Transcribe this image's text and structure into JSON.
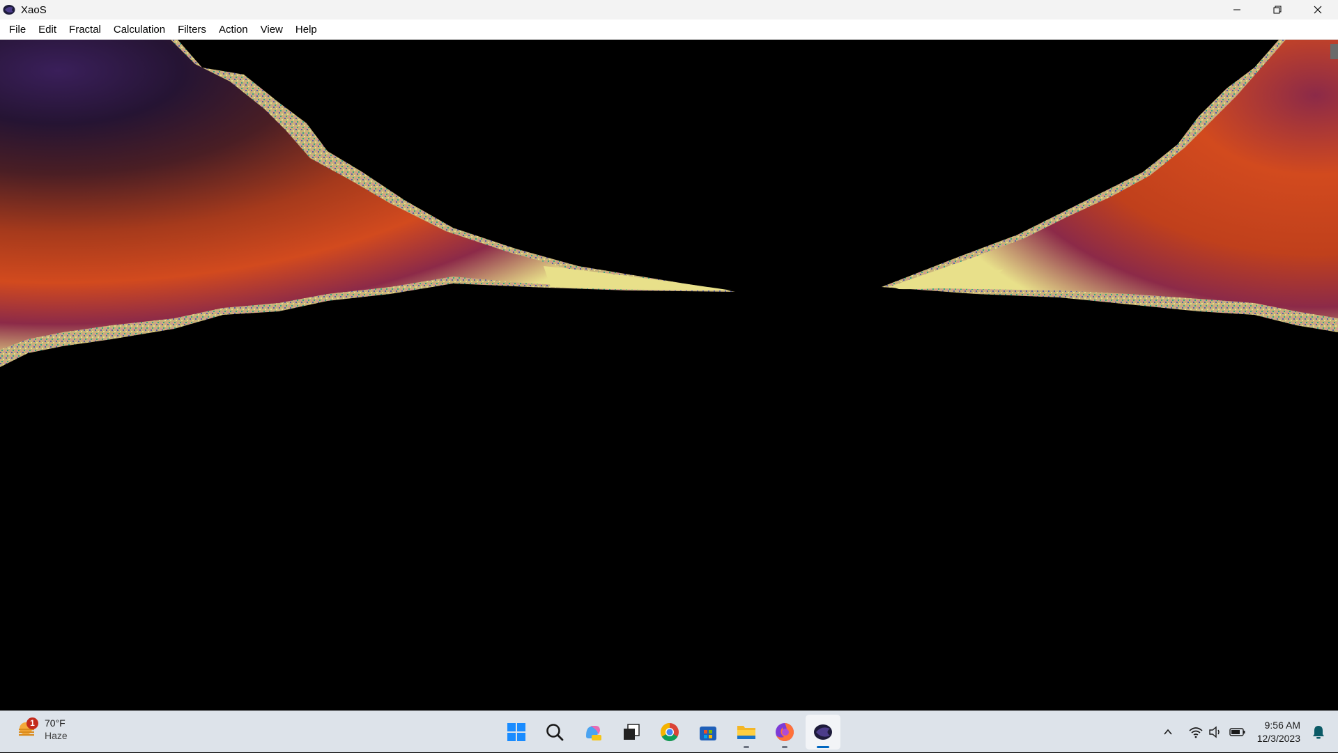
{
  "window": {
    "title": "XaoS",
    "icon": "xaos-app-icon"
  },
  "menu": [
    "File",
    "Edit",
    "Fractal",
    "Calculation",
    "Filters",
    "Action",
    "View",
    "Help"
  ],
  "canvas": {
    "content": "mandelbrot-fractal-render",
    "colors": {
      "interior": "#000000",
      "orange": "#d24a1e",
      "crimson": "#8c2a48",
      "yellow": "#e8e08a",
      "violet": "#3a1f5a"
    }
  },
  "taskbar": {
    "weather": {
      "temp": "70°F",
      "condition": "Haze",
      "badge": "1"
    },
    "apps": [
      {
        "name": "start-icon"
      },
      {
        "name": "search-icon"
      },
      {
        "name": "copilot-icon"
      },
      {
        "name": "task-view-icon"
      },
      {
        "name": "chrome-icon"
      },
      {
        "name": "microsoft-store-icon"
      },
      {
        "name": "file-explorer-icon"
      },
      {
        "name": "firefox-icon"
      },
      {
        "name": "xaos-icon"
      }
    ],
    "clock": {
      "time": "9:56 AM",
      "date": "12/3/2023"
    }
  }
}
